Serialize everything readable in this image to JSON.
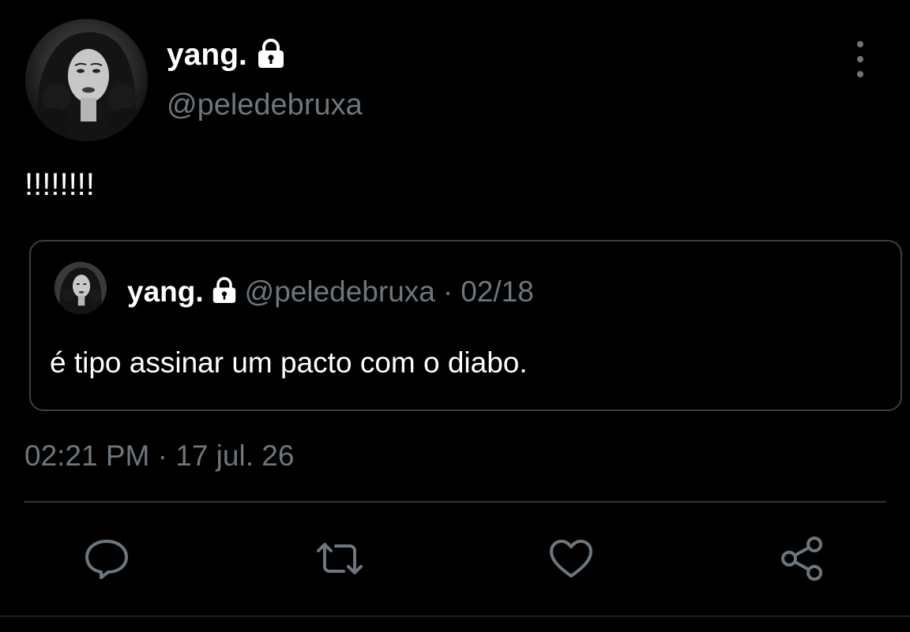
{
  "author": {
    "display_name": "yang.",
    "handle": "@peledebruxa",
    "locked_icon": "lock-icon"
  },
  "tweet": {
    "text": "!!!!!!!!",
    "timestamp": "02:21 PM · 17 jul. 26"
  },
  "quote": {
    "display_name": "yang.",
    "handle": "@peledebruxa",
    "separator": "·",
    "date": "02/18",
    "text": "é tipo assinar um pacto com o diabo."
  },
  "actions": [
    {
      "name": "reply",
      "icon": "reply-icon"
    },
    {
      "name": "retweet",
      "icon": "retweet-icon"
    },
    {
      "name": "like",
      "icon": "heart-icon"
    },
    {
      "name": "share",
      "icon": "share-icon"
    }
  ],
  "colors": {
    "background": "#000000",
    "primary_text": "#ffffff",
    "secondary_text": "#6e767d",
    "border": "#3b3f44"
  }
}
